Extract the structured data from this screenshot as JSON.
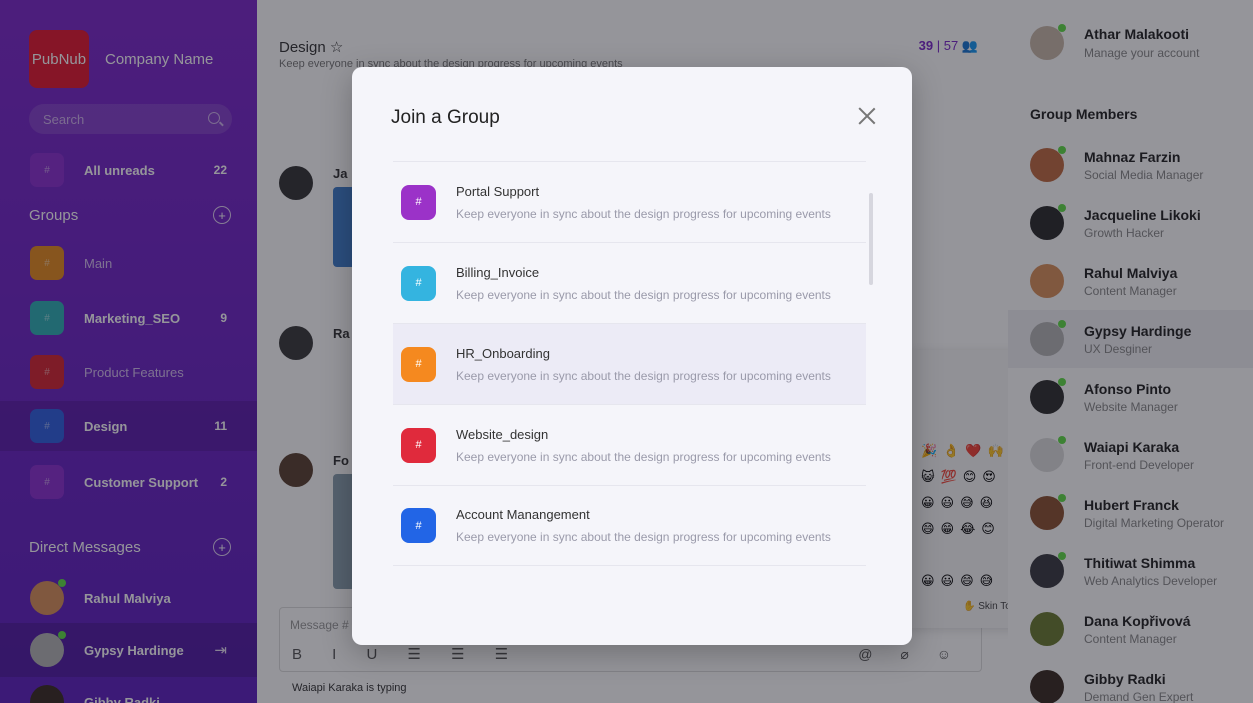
{
  "brand": {
    "logo": "PubNub",
    "company": "Company Name"
  },
  "search": {
    "placeholder": "Search"
  },
  "sidebar": {
    "all_unreads": {
      "label": "All unreads",
      "count": "22",
      "color": "#8a2fd0"
    },
    "groups_title": "Groups",
    "groups": [
      {
        "label": "Main",
        "count": "",
        "color": "#e58a1e",
        "bold": false
      },
      {
        "label": "Marketing_SEO",
        "count": "9",
        "color": "#2fb0b5",
        "bold": true
      },
      {
        "label": "Product Features",
        "count": "",
        "color": "#d62430",
        "bold": false
      },
      {
        "label": "Design",
        "count": "11",
        "color": "#2f5fe0",
        "bold": true
      },
      {
        "label": "Customer Support",
        "count": "2",
        "color": "#8a2fd0",
        "bold": true
      }
    ],
    "dm_title": "Direct Messages",
    "dms": [
      {
        "label": "Rahul Malviya"
      },
      {
        "label": "Gypsy Hardinge"
      },
      {
        "label": "Gibby Radki"
      }
    ]
  },
  "chat": {
    "title": "Design",
    "subtitle": "Keep everyone in sync about the design progress for upcoming events",
    "stats_online": "39",
    "stats_total": "57",
    "msg_names": [
      "Ja",
      "Ra",
      "Fo"
    ],
    "input_placeholder": "Message #",
    "typing": "Waiapi Karaka is typing",
    "skin_tone": "Skin Tone"
  },
  "right": {
    "me": {
      "name": "Athar Malakooti",
      "sub": "Manage your account"
    },
    "members_title": "Group Members",
    "members": [
      {
        "name": "Mahnaz Farzin",
        "role": "Social Media Manager"
      },
      {
        "name": "Jacqueline Likoki",
        "role": "Growth Hacker"
      },
      {
        "name": "Rahul Malviya",
        "role": "Content Manager"
      },
      {
        "name": "Gypsy Hardinge",
        "role": "UX Desginer"
      },
      {
        "name": "Afonso Pinto",
        "role": "Website Manager"
      },
      {
        "name": "Waiapi Karaka",
        "role": "Front-end Developer"
      },
      {
        "name": "Hubert Franck",
        "role": "Digital Marketing Operator"
      },
      {
        "name": "Thitiwat Shimma",
        "role": "Web Analytics Developer"
      },
      {
        "name": "Dana Kopřivová",
        "role": "Content Manager"
      },
      {
        "name": "Gibby Radki",
        "role": "Demand Gen Expert"
      }
    ]
  },
  "modal": {
    "title": "Join a Group",
    "groups": [
      {
        "name": "Portal Support",
        "desc": "Keep everyone in sync about the design progress for upcoming events",
        "color": "#9b32c8"
      },
      {
        "name": "Billing_Invoice",
        "desc": "Keep everyone in sync about the design progress for upcoming events",
        "color": "#34b4e0"
      },
      {
        "name": "HR_Onboarding",
        "desc": "Keep everyone in sync about the design progress for upcoming events",
        "color": "#f5891f"
      },
      {
        "name": "Website_design",
        "desc": "Keep everyone in sync about the design progress for upcoming events",
        "color": "#e02a3c"
      },
      {
        "name": "Account Manangement",
        "desc": "Keep everyone in sync about the design progress for upcoming events",
        "color": "#2265e6"
      }
    ]
  }
}
